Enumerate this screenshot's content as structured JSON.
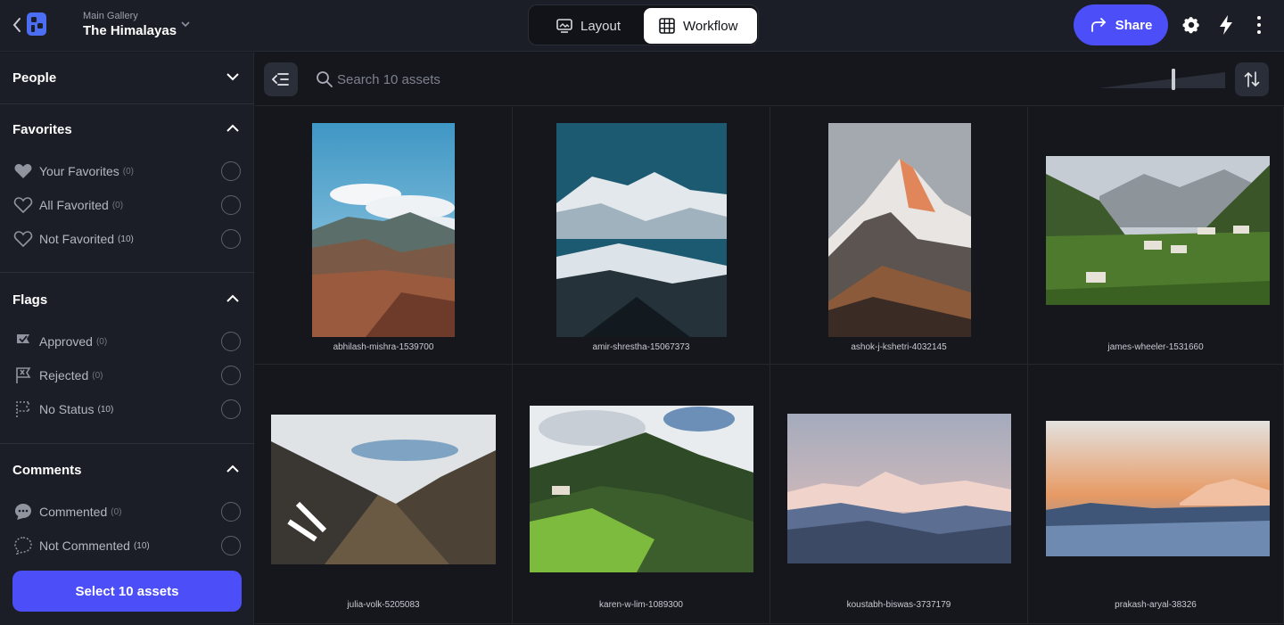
{
  "header": {
    "gallery_label": "Main Gallery",
    "gallery_title": "The Himalayas",
    "view_tabs": [
      {
        "label": "Layout",
        "icon": "layout-icon",
        "active": false
      },
      {
        "label": "Workflow",
        "icon": "grid-icon",
        "active": true
      }
    ],
    "share_label": "Share",
    "accent_color": "#4c4ef7"
  },
  "sidebar": {
    "sections": [
      {
        "title": "People",
        "expanded": false,
        "rows": []
      },
      {
        "title": "Favorites",
        "expanded": true,
        "rows": [
          {
            "label": "Your Favorites",
            "count": "(0)",
            "icon": "heart-filled-icon"
          },
          {
            "label": "All Favorited",
            "count": "(0)",
            "icon": "heart-outline-icon"
          },
          {
            "label": "Not Favorited",
            "count": "(10)",
            "icon": "heart-outline-icon"
          }
        ]
      },
      {
        "title": "Flags",
        "expanded": true,
        "rows": [
          {
            "label": "Approved",
            "count": "(0)",
            "icon": "flag-check-icon"
          },
          {
            "label": "Rejected",
            "count": "(0)",
            "icon": "flag-x-icon"
          },
          {
            "label": "No Status",
            "count": "(10)",
            "icon": "flag-dashed-icon"
          }
        ]
      },
      {
        "title": "Comments",
        "expanded": true,
        "rows": [
          {
            "label": "Commented",
            "count": "(0)",
            "icon": "comment-filled-icon"
          },
          {
            "label": "Not Commented",
            "count": "(10)",
            "icon": "comment-dashed-icon"
          }
        ]
      }
    ],
    "select_button_label": "Select 10 assets"
  },
  "toolbar": {
    "search_placeholder": "Search 10 assets"
  },
  "assets": [
    {
      "name": "abhilash-mishra-1539700"
    },
    {
      "name": "amir-shrestha-15067373"
    },
    {
      "name": "ashok-j-kshetri-4032145"
    },
    {
      "name": "james-wheeler-1531660"
    },
    {
      "name": "julia-volk-5205083"
    },
    {
      "name": "karen-w-lim-1089300"
    },
    {
      "name": "koustabh-biswas-3737179"
    },
    {
      "name": "prakash-aryal-38326"
    }
  ]
}
